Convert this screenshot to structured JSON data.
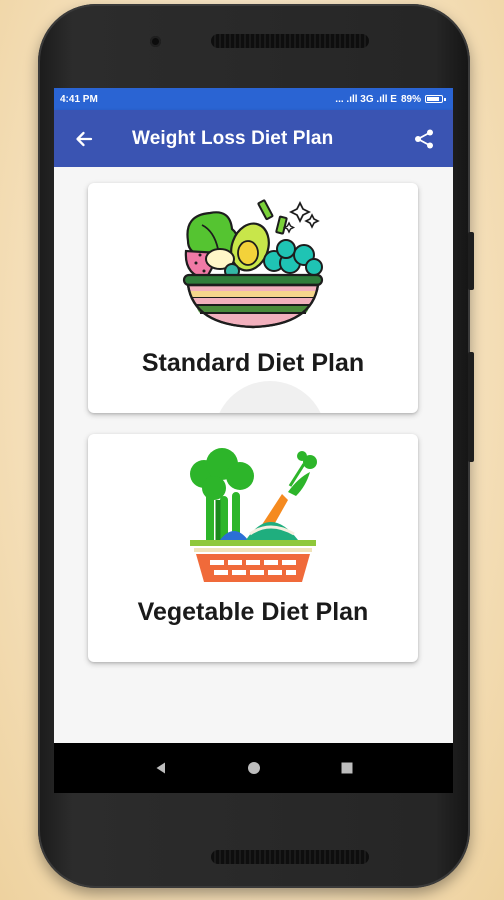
{
  "status_bar": {
    "time": "4:41 PM",
    "indicators": "... .ıll 3G .ıll E",
    "battery": "89%"
  },
  "app_bar": {
    "title": "Weight Loss Diet Plan",
    "back_icon": "arrow-back-icon",
    "share_icon": "share-icon"
  },
  "cards": [
    {
      "title": "Standard Diet Plan",
      "icon": "salad-bowl-icon"
    },
    {
      "title": "Vegetable Diet Plan",
      "icon": "vegetable-basket-icon"
    }
  ],
  "nav_bar": {
    "back": "nav-back-icon",
    "home": "nav-home-icon",
    "recents": "nav-recents-icon"
  },
  "colors": {
    "status_bar": "#2a64d3",
    "app_bar": "#3a54b2",
    "background": "#f6f6f6"
  }
}
